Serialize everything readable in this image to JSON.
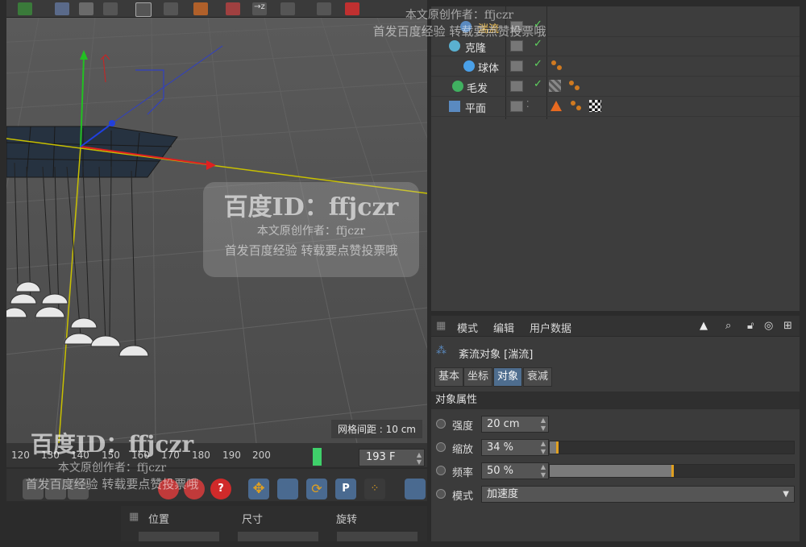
{
  "viewport": {
    "grid_spacing": "网格间距 : 10 cm"
  },
  "object_manager": {
    "objects": [
      {
        "name": "湍流",
        "icon": "turbulence-icon",
        "checked": true
      },
      {
        "name": "克隆",
        "icon": "cloner-icon",
        "checked": true
      },
      {
        "name": "球体",
        "icon": "sphere-icon",
        "checked": true
      },
      {
        "name": "毛发",
        "icon": "hair-icon",
        "checked": true
      },
      {
        "name": "平面",
        "icon": "plane-icon",
        "checked": false
      }
    ]
  },
  "attributes": {
    "menu": [
      "模式",
      "编辑",
      "用户数据"
    ],
    "object_title": "紊流对象 [湍流]",
    "tabs": [
      "基本",
      "坐标",
      "对象",
      "衰减"
    ],
    "active_tab": "对象",
    "section_title": "对象属性",
    "properties": [
      {
        "label": "强度",
        "value": "20 cm",
        "fraction": 0
      },
      {
        "label": "缩放",
        "value": "34 %",
        "fraction": 0.03
      },
      {
        "label": "频率",
        "value": "50 %",
        "fraction": 0.5
      },
      {
        "label": "模式",
        "value": "加速度"
      }
    ]
  },
  "timeline": {
    "ticks": [
      "120",
      "130",
      "140",
      "150",
      "160",
      "170",
      "180",
      "190",
      "200"
    ],
    "current_frame": "193 F",
    "playhead_frame": 193
  },
  "coordinates": {
    "headers": [
      "位置",
      "尺寸",
      "旋转"
    ]
  },
  "watermark": {
    "brand": "百度ID：",
    "id": "ffjczr",
    "line1": "本文原创作者：ffjczr",
    "line2": "首发百度经验 转载要点赞投票哦"
  },
  "colors": {
    "accent": "#4e6d8e",
    "check": "#5fd35f",
    "knob": "#e0a020"
  }
}
